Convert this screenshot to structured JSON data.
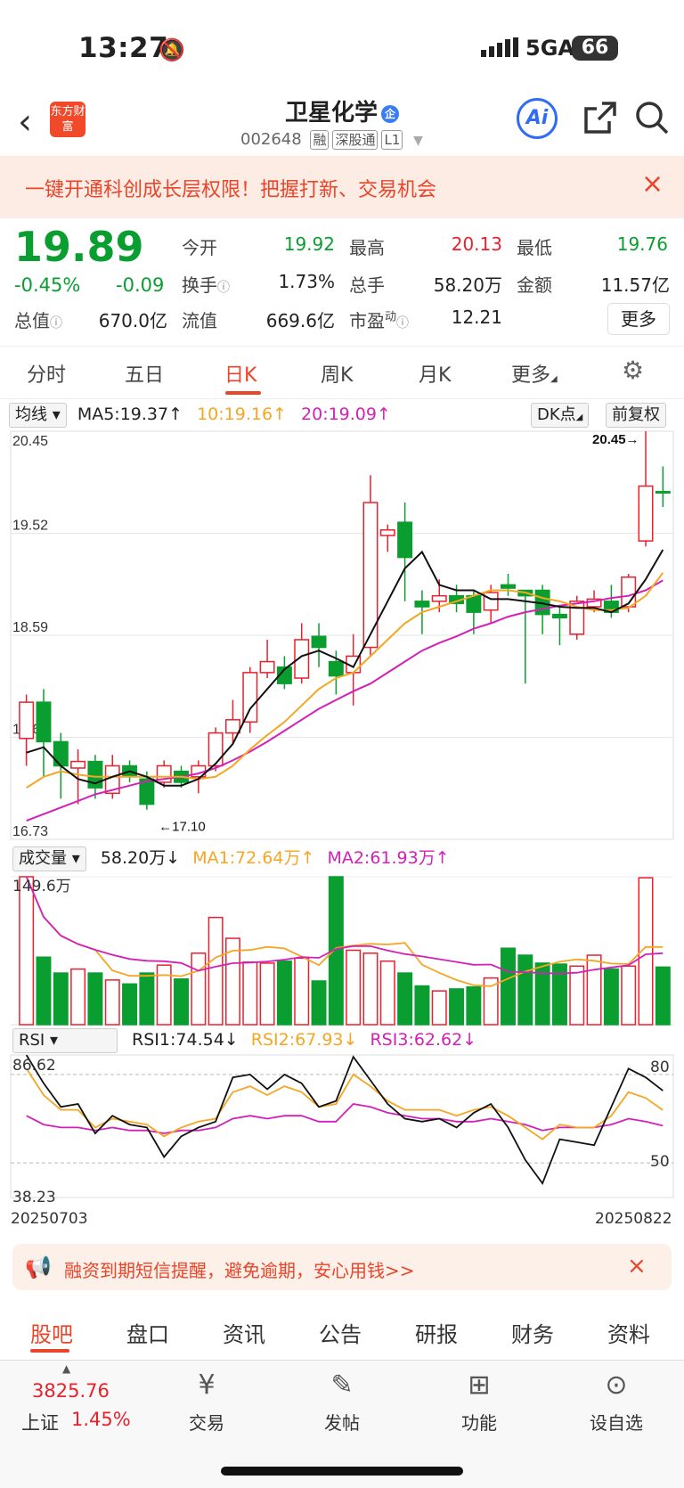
{
  "status": {
    "time": "13:27",
    "network": "5GA",
    "battery": "66"
  },
  "header": {
    "back": "‹",
    "logo": "东方财富",
    "title": "卫星化学",
    "qiye_badge": "企",
    "code": "002648",
    "tags": [
      "融",
      "深股通",
      "L1"
    ],
    "ai": "Ai"
  },
  "banner": {
    "text": "一键开通科创成长层权限！把握打新、交易机会",
    "close": "×"
  },
  "quote": {
    "price": "19.89",
    "change_pct": "-0.45%",
    "change": "-0.09",
    "open_label": "今开",
    "open": "19.92",
    "high_label": "最高",
    "high": "20.13",
    "low_label": "最低",
    "low": "19.76",
    "turnover_label": "换手",
    "turnover": "1.73%",
    "volume_label": "总手",
    "volume": "58.20万",
    "amount_label": "金额",
    "amount": "11.57亿",
    "mcap_label": "总值",
    "mcap": "670.0亿",
    "float_label": "流值",
    "float": "669.6亿",
    "pe_label": "市盈",
    "pe_sup": "动",
    "pe": "12.21",
    "more": "更多"
  },
  "tabs": [
    "分时",
    "五日",
    "日K",
    "周K",
    "月K",
    "更多"
  ],
  "ma": {
    "selector": "均线",
    "ma5": "MA5:19.37↑",
    "ma10": "10:19.16↑",
    "ma20": "20:19.09↑",
    "dk": "DK点",
    "fq": "前复权"
  },
  "vol": {
    "selector": "成交量",
    "value": "58.20万↓",
    "ma1": "MA1:72.64万↑",
    "ma2": "MA2:61.93万↑",
    "max": "149.6万"
  },
  "rsi": {
    "selector": "RSI",
    "rsi1": "RSI1:74.54↓",
    "rsi2": "RSI2:67.93↓",
    "rsi3": "RSI3:62.62↓",
    "top": "86.62",
    "bottom": "38.23",
    "lvl80": "80",
    "lvl50": "50",
    "date_start": "20250703",
    "date_end": "20250822"
  },
  "notice": {
    "text": "融资到期短信提醒，避免逾期，安心用钱>>",
    "close": "×"
  },
  "bottom_tabs": [
    "股吧",
    "盘口",
    "资讯",
    "公告",
    "研报",
    "财务",
    "资料"
  ],
  "footer": {
    "index_value": "3825.76",
    "index_name": "上证",
    "index_pct": "1.45%",
    "items": [
      "交易",
      "发帖",
      "功能",
      "设自选"
    ]
  },
  "colors": {
    "up": "#e8212e",
    "down": "#0a9e30",
    "accent": "#e8452a",
    "ma5": "#111111",
    "ma10": "#f5a623",
    "ma20": "#d321b8"
  },
  "chart_data": {
    "type": "candlestick",
    "y_labels": [
      "20.45",
      "19.52",
      "18.59",
      "17.66",
      "16.73"
    ],
    "ylim": [
      16.73,
      20.45
    ],
    "annotations": {
      "high": "20.45→",
      "low": "←17.10"
    },
    "candles": [
      {
        "o": 17.65,
        "c": 17.98,
        "h": 18.05,
        "l": 17.4
      },
      {
        "o": 17.98,
        "c": 17.62,
        "h": 18.1,
        "l": 17.3
      },
      {
        "o": 17.62,
        "c": 17.4,
        "h": 17.7,
        "l": 17.1
      },
      {
        "o": 17.38,
        "c": 17.44,
        "h": 17.55,
        "l": 17.05
      },
      {
        "o": 17.44,
        "c": 17.2,
        "h": 17.5,
        "l": 17.1
      },
      {
        "o": 17.15,
        "c": 17.4,
        "h": 17.5,
        "l": 17.1
      },
      {
        "o": 17.4,
        "c": 17.3,
        "h": 17.45,
        "l": 17.25
      },
      {
        "o": 17.28,
        "c": 17.05,
        "h": 17.35,
        "l": 17.0
      },
      {
        "o": 17.25,
        "c": 17.4,
        "h": 17.45,
        "l": 17.2
      },
      {
        "o": 17.35,
        "c": 17.25,
        "h": 17.4,
        "l": 17.2
      },
      {
        "o": 17.3,
        "c": 17.4,
        "h": 17.45,
        "l": 17.15
      },
      {
        "o": 17.4,
        "c": 17.7,
        "h": 17.75,
        "l": 17.35
      },
      {
        "o": 17.7,
        "c": 17.82,
        "h": 18.0,
        "l": 17.6
      },
      {
        "o": 17.8,
        "c": 18.25,
        "h": 18.3,
        "l": 17.7
      },
      {
        "o": 18.25,
        "c": 18.35,
        "h": 18.55,
        "l": 18.2
      },
      {
        "o": 18.3,
        "c": 18.15,
        "h": 18.4,
        "l": 18.1
      },
      {
        "o": 18.2,
        "c": 18.55,
        "h": 18.7,
        "l": 18.15
      },
      {
        "o": 18.58,
        "c": 18.48,
        "h": 18.7,
        "l": 18.3
      },
      {
        "o": 18.35,
        "c": 18.22,
        "h": 18.45,
        "l": 18.05
      },
      {
        "o": 18.25,
        "c": 18.4,
        "h": 18.6,
        "l": 17.95
      },
      {
        "o": 18.48,
        "c": 19.8,
        "h": 20.05,
        "l": 18.4
      },
      {
        "o": 19.5,
        "c": 19.55,
        "h": 19.6,
        "l": 19.35
      },
      {
        "o": 19.62,
        "c": 19.3,
        "h": 19.8,
        "l": 18.9
      },
      {
        "o": 18.9,
        "c": 18.85,
        "h": 19.0,
        "l": 18.6
      },
      {
        "o": 18.9,
        "c": 18.95,
        "h": 19.1,
        "l": 18.8
      },
      {
        "o": 18.95,
        "c": 18.88,
        "h": 19.05,
        "l": 18.8
      },
      {
        "o": 18.95,
        "c": 18.8,
        "h": 19.0,
        "l": 18.6
      },
      {
        "o": 18.82,
        "c": 18.98,
        "h": 19.05,
        "l": 18.7
      },
      {
        "o": 19.05,
        "c": 19.02,
        "h": 19.15,
        "l": 18.95
      },
      {
        "o": 19.0,
        "c": 18.95,
        "h": 19.0,
        "l": 18.15
      },
      {
        "o": 19.0,
        "c": 18.78,
        "h": 19.05,
        "l": 18.6
      },
      {
        "o": 18.78,
        "c": 18.75,
        "h": 18.85,
        "l": 18.5
      },
      {
        "o": 18.6,
        "c": 18.9,
        "h": 18.95,
        "l": 18.55
      },
      {
        "o": 18.85,
        "c": 18.92,
        "h": 19.0,
        "l": 18.8
      },
      {
        "o": 18.9,
        "c": 18.8,
        "h": 19.05,
        "l": 18.75
      },
      {
        "o": 18.85,
        "c": 19.12,
        "h": 19.15,
        "l": 18.8
      },
      {
        "o": 19.45,
        "c": 19.95,
        "h": 20.45,
        "l": 19.4
      },
      {
        "o": 19.9,
        "c": 19.89,
        "h": 20.13,
        "l": 19.76
      }
    ],
    "ma5": [
      17.52,
      17.57,
      17.4,
      17.28,
      17.24,
      17.3,
      17.35,
      17.3,
      17.22,
      17.22,
      17.28,
      17.42,
      17.6,
      17.92,
      18.1,
      18.28,
      18.4,
      18.45,
      18.38,
      18.3,
      18.6,
      18.9,
      19.2,
      19.35,
      19.05,
      19.0,
      19.0,
      18.92,
      18.92,
      18.9,
      18.88,
      18.85,
      18.84,
      18.84,
      18.8,
      18.88,
      19.1,
      19.37
    ],
    "ma10": [
      17.2,
      17.3,
      17.35,
      17.32,
      17.3,
      17.3,
      17.3,
      17.3,
      17.3,
      17.3,
      17.28,
      17.3,
      17.4,
      17.55,
      17.68,
      17.8,
      17.95,
      18.1,
      18.2,
      18.25,
      18.4,
      18.55,
      18.7,
      18.8,
      18.85,
      18.9,
      18.95,
      19.0,
      19.0,
      18.98,
      18.93,
      18.9,
      18.85,
      18.82,
      18.82,
      18.84,
      18.95,
      19.16
    ],
    "ma20": [
      16.9,
      16.96,
      17.02,
      17.08,
      17.14,
      17.18,
      17.22,
      17.26,
      17.28,
      17.3,
      17.33,
      17.38,
      17.45,
      17.53,
      17.62,
      17.72,
      17.82,
      17.92,
      18.0,
      18.08,
      18.15,
      18.25,
      18.35,
      18.45,
      18.52,
      18.58,
      18.65,
      18.7,
      18.76,
      18.8,
      18.83,
      18.86,
      18.88,
      18.9,
      18.93,
      18.95,
      19.0,
      19.09
    ],
    "volume": [
      149,
      68,
      52,
      56,
      52,
      45,
      41,
      52,
      60,
      46,
      72,
      108,
      87,
      63,
      62,
      64,
      67,
      44,
      149,
      75,
      72,
      64,
      52,
      39,
      34,
      36,
      38,
      47,
      77,
      70,
      62,
      61,
      59,
      70,
      56,
      59,
      148,
      58
    ],
    "rsi1": [
      86.6,
      77,
      69,
      70,
      60,
      66,
      63,
      62,
      52,
      59,
      62,
      64,
      79,
      80,
      75,
      80,
      77,
      69,
      71,
      86,
      78,
      70,
      65,
      64,
      65,
      62,
      67,
      70,
      62,
      51,
      43,
      58,
      57,
      56,
      69,
      82,
      79,
      74.5
    ],
    "rsi2": [
      82,
      73,
      68,
      68,
      62,
      65,
      64,
      63,
      59,
      62,
      64,
      65,
      74,
      76,
      73,
      76,
      74,
      69,
      70,
      80,
      76,
      71,
      68,
      68,
      68,
      66,
      68,
      69,
      66,
      62,
      58,
      63,
      62,
      62,
      66,
      74,
      72,
      67.9
    ],
    "rsi3": [
      66,
      63,
      62,
      62,
      61,
      62,
      61,
      61,
      60,
      61,
      61,
      62,
      65,
      66,
      65,
      66,
      66,
      64,
      64,
      70,
      69,
      67,
      66,
      65,
      65,
      64,
      64,
      65,
      64,
      63,
      61,
      62,
      62,
      62,
      63,
      65,
      64,
      62.6
    ]
  }
}
